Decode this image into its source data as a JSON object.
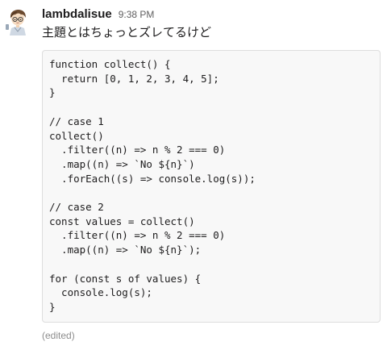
{
  "message": {
    "sender": "lambdalisue",
    "timestamp": "9:38 PM",
    "text": "主題とはちょっとズレてるけど",
    "code": "function collect() {\n  return [0, 1, 2, 3, 4, 5];\n}\n\n// case 1\ncollect()\n  .filter((n) => n % 2 === 0)\n  .map((n) => `No ${n}`)\n  .forEach((s) => console.log(s));\n\n// case 2\nconst values = collect()\n  .filter((n) => n % 2 === 0)\n  .map((n) => `No ${n}`);\n\nfor (const s of values) {\n  console.log(s);\n}",
    "edited_label": "(edited)"
  },
  "avatar": {
    "icon": "user-avatar-icon"
  },
  "colors": {
    "code_background": "#f8f8f8",
    "code_border": "#dddddd",
    "timestamp": "#616061",
    "edited": "#8d8d8d"
  }
}
